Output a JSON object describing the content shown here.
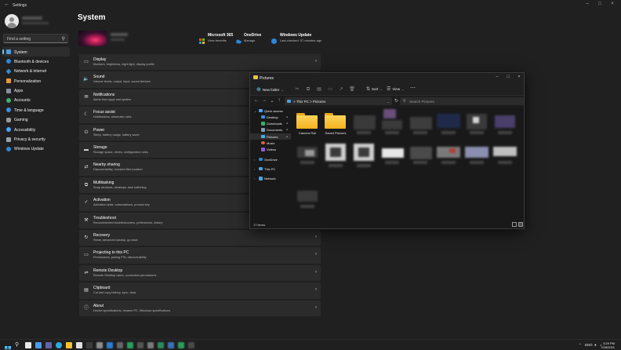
{
  "settings": {
    "window_title": "Settings",
    "search_placeholder": "Find a setting",
    "page_title": "System",
    "nav": [
      {
        "label": "System",
        "icon": "monitor-icon",
        "active": true
      },
      {
        "label": "Bluetooth & devices",
        "icon": "bluetooth-icon"
      },
      {
        "label": "Network & internet",
        "icon": "network-icon"
      },
      {
        "label": "Personalization",
        "icon": "brush-icon"
      },
      {
        "label": "Apps",
        "icon": "apps-icon"
      },
      {
        "label": "Accounts",
        "icon": "person-icon"
      },
      {
        "label": "Time & language",
        "icon": "globe-clock-icon"
      },
      {
        "label": "Gaming",
        "icon": "gamepad-icon"
      },
      {
        "label": "Accessibility",
        "icon": "accessibility-icon"
      },
      {
        "label": "Privacy & security",
        "icon": "shield-icon"
      },
      {
        "label": "Windows Update",
        "icon": "update-icon"
      }
    ],
    "status": [
      {
        "title": "Microsoft 365",
        "sub": "View benefits",
        "icon": "microsoft-logo-icon"
      },
      {
        "title": "OneDrive",
        "sub": "Manage",
        "icon": "cloud-icon"
      },
      {
        "title": "Windows Update",
        "sub": "Last checked: 57 minutes ago",
        "icon": "update-icon"
      }
    ],
    "cards": [
      {
        "title": "Display",
        "sub": "Monitors, brightness, night light, display profile",
        "icon": "display-icon"
      },
      {
        "title": "Sound",
        "sub": "Volume levels, output, input, sound devices",
        "icon": "speaker-icon"
      },
      {
        "title": "Notifications",
        "sub": "Alerts from apps and system",
        "icon": "bell-icon"
      },
      {
        "title": "Focus assist",
        "sub": "Notifications, automatic rules",
        "icon": "moon-icon"
      },
      {
        "title": "Power",
        "sub": "Sleep, battery usage, battery saver",
        "icon": "power-icon"
      },
      {
        "title": "Storage",
        "sub": "Storage space, drives, configuration rules",
        "icon": "storage-icon"
      },
      {
        "title": "Nearby sharing",
        "sub": "Discoverability, received files location",
        "icon": "share-icon"
      },
      {
        "title": "Multitasking",
        "sub": "Snap windows, desktops, task switching",
        "icon": "multitask-icon"
      },
      {
        "title": "Activation",
        "sub": "Activation state, subscriptions, product key",
        "icon": "check-circle-icon"
      },
      {
        "title": "Troubleshoot",
        "sub": "Recommended troubleshooters, preferences, history",
        "icon": "wrench-icon"
      },
      {
        "title": "Recovery",
        "sub": "Reset, advanced startup, go back",
        "icon": "recovery-icon"
      },
      {
        "title": "Projecting to this PC",
        "sub": "Permissions, pairing PIN, discoverability",
        "icon": "project-icon"
      },
      {
        "title": "Remote Desktop",
        "sub": "Remote Desktop users, connection permissions",
        "icon": "remote-icon"
      },
      {
        "title": "Clipboard",
        "sub": "Cut and copy history, sync, clear",
        "icon": "clipboard-icon"
      },
      {
        "title": "About",
        "sub": "Device specifications, rename PC, Windows specifications",
        "icon": "info-icon"
      }
    ]
  },
  "explorer": {
    "title": "Pictures",
    "new_folder": "New folder",
    "sort": "Sort",
    "view": "View",
    "path_root": "This PC",
    "path_leaf": "Pictures",
    "breadcrumb_sep": ">",
    "search_placeholder": "Search Pictures",
    "sidebar": [
      {
        "label": "Quick access",
        "icon": "star-icon",
        "expandable": true
      },
      {
        "label": "Desktop",
        "icon": "desktop-folder-icon",
        "pinned": true
      },
      {
        "label": "Downloads",
        "icon": "download-icon",
        "pinned": true
      },
      {
        "label": "Documents",
        "icon": "documents-icon",
        "pinned": true
      },
      {
        "label": "Pictures",
        "icon": "pictures-icon",
        "pinned": true,
        "selected": true
      },
      {
        "label": "Music",
        "icon": "music-icon"
      },
      {
        "label": "Videos",
        "icon": "videos-icon"
      },
      {
        "label": "OneDrive",
        "icon": "cloud-icon",
        "expandable": true
      },
      {
        "label": "This PC",
        "icon": "pc-icon",
        "expandable": true
      },
      {
        "label": "Network",
        "icon": "network-icon",
        "expandable": true
      }
    ],
    "folders": [
      {
        "label": "Camera Roll"
      },
      {
        "label": "Saved Pictures"
      }
    ],
    "status": "17 items"
  },
  "taskbar": {
    "tray_lang": "ENG",
    "time": "3:29 PM",
    "date": "7/26/2021"
  },
  "colors": {
    "accent": "#60cdff",
    "folder": "#f5c02f",
    "window_bg": "#202020",
    "card_bg": "#2b2b2b"
  }
}
